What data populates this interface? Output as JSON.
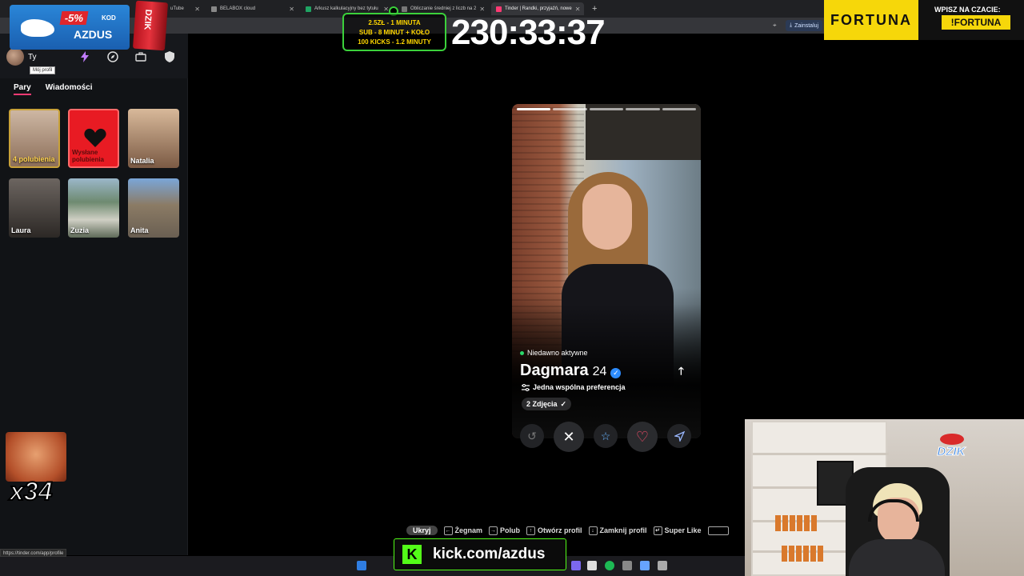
{
  "browser": {
    "tabs": [
      {
        "label": "uTube",
        "color": "#e00"
      },
      {
        "label": "BELABOX cloud",
        "color": "#888"
      },
      {
        "label": "Arkusz kalkulacyjny bez tytułu",
        "color": "#1fa463"
      },
      {
        "label": "Obliczanie średniej z liczb na 2",
        "color": "#777"
      },
      {
        "label": "Tinder | Randki, przyjaźń, nowe",
        "color": "#fd3a73"
      }
    ],
    "install_label": "Zainstaluj",
    "status_url": "https://tinder.com/app/profile"
  },
  "sidebar": {
    "you_label": "Ty",
    "tooltip": "Mój profil",
    "tabs": {
      "pairs": "Pary",
      "messages": "Wiadomości"
    },
    "likes_tile": "4 polubienia",
    "sent_tile": "Wysłane polubienia",
    "matches": [
      "Natalia",
      "Laura",
      "Zuzia",
      "Anita"
    ]
  },
  "overlay": {
    "promo_discount": "-5%",
    "promo_kod": "KOD",
    "promo_code": "AZDUS",
    "promo_can": "DZIK",
    "subs_line1": "2.5ZŁ - 1 MINUTA",
    "subs_line2": "SUB - 8 MINUT + KOŁO",
    "subs_line3": "100 KICKS - 1.2 MINUTY",
    "timer": "230:33:37",
    "fortuna_logo": "FORTUNA",
    "fortuna_tag": "WPISZ NA CZACIE:",
    "fortuna_badge": "!FORTUNA",
    "counter": "x34",
    "kick_url": "kick.com/azdus",
    "webcam_logo": "DZIK"
  },
  "profile": {
    "status": "Niedawno aktywne",
    "name": "Dagmara",
    "age": "24",
    "preference": "Jedna wspólna preferencja",
    "photos_chip": "2 Zdjęcia",
    "photo_count": 5,
    "current_photo": 1
  },
  "hints": {
    "hide": "Ukryj",
    "nope": "Żegnam",
    "like": "Polub",
    "open_profile": "Otwórz profil",
    "close_profile": "Zamknij profil",
    "super_like": "Super Like"
  },
  "colors": {
    "tinder_pink": "#fd3a73",
    "kick_green": "#53fc18",
    "fortuna_yellow": "#f6d70a"
  }
}
